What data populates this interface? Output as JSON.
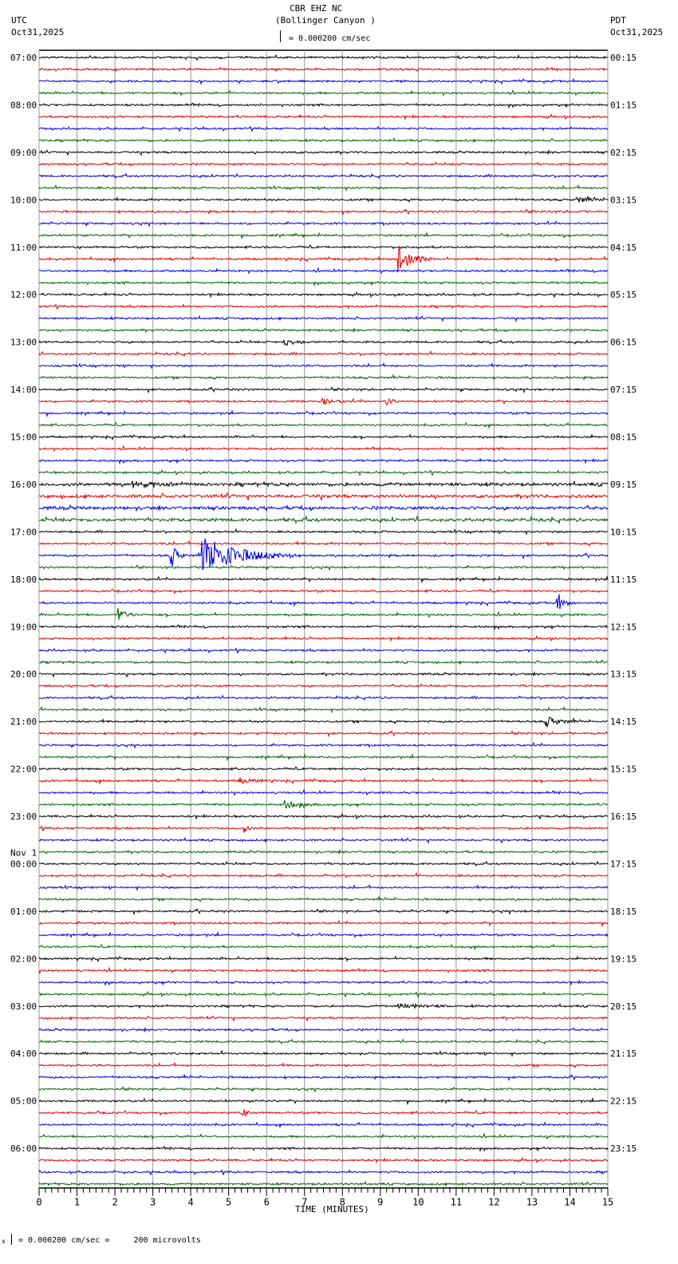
{
  "header": {
    "station": "CBR EHZ NC",
    "location": "(Bollinger Canyon )",
    "scale_text": "= 0.000200 cm/sec",
    "left_tz": "UTC",
    "left_date": "Oct31,2025",
    "right_tz": "PDT",
    "right_date": "Oct31,2025"
  },
  "footer": {
    "scale_prefix": "x",
    "scale_text": "= 0.000200 cm/sec =     200 microvolts"
  },
  "chart_data": {
    "type": "line",
    "title": "CBR EHZ NC (Bollinger Canyon )",
    "xlabel": "TIME (MINUTES)",
    "xlim": [
      0,
      15
    ],
    "x_ticks": [
      "0",
      "1",
      "2",
      "3",
      "4",
      "5",
      "6",
      "7",
      "8",
      "9",
      "10",
      "11",
      "12",
      "13",
      "14",
      "15"
    ],
    "traces_per_hour": 4,
    "trace_colors": [
      "#000000",
      "#e00000",
      "#0000e0",
      "#006400"
    ],
    "left_labels": [
      "07:00",
      "08:00",
      "09:00",
      "10:00",
      "11:00",
      "12:00",
      "13:00",
      "14:00",
      "15:00",
      "16:00",
      "17:00",
      "18:00",
      "19:00",
      "20:00",
      "21:00",
      "22:00",
      "23:00",
      "00:00",
      "01:00",
      "02:00",
      "03:00",
      "04:00",
      "05:00",
      "06:00"
    ],
    "day_change_label": "Nov 1",
    "right_labels": [
      "00:15",
      "01:15",
      "02:15",
      "03:15",
      "04:15",
      "05:15",
      "06:15",
      "07:15",
      "08:15",
      "09:15",
      "10:15",
      "11:15",
      "12:15",
      "13:15",
      "14:15",
      "15:15",
      "16:15",
      "17:15",
      "18:15",
      "19:15",
      "20:15",
      "21:15",
      "22:15",
      "23:15"
    ],
    "events": [
      {
        "trace": 17,
        "minute": 9.5,
        "amplitude": 20,
        "duration": 0.8
      },
      {
        "trace": 42,
        "minute": 3.5,
        "amplitude": 14,
        "duration": 0.4
      },
      {
        "trace": 42,
        "minute": 4.3,
        "amplitude": 24,
        "duration": 2.5
      },
      {
        "trace": 46,
        "minute": 13.7,
        "amplitude": 10,
        "duration": 0.4
      },
      {
        "trace": 47,
        "minute": 2.1,
        "amplitude": 8,
        "duration": 0.5
      },
      {
        "trace": 56,
        "minute": 13.4,
        "amplitude": 6,
        "duration": 0.8
      },
      {
        "trace": 29,
        "minute": 9.2,
        "amplitude": 6,
        "duration": 0.3
      },
      {
        "trace": 29,
        "minute": 7.5,
        "amplitude": 3,
        "duration": 0.8
      },
      {
        "trace": 61,
        "minute": 5.3,
        "amplitude": 3,
        "duration": 1.0
      },
      {
        "trace": 63,
        "minute": 6.5,
        "amplitude": 4,
        "duration": 1.0
      },
      {
        "trace": 65,
        "minute": 5.4,
        "amplitude": 5,
        "duration": 0.3
      },
      {
        "trace": 89,
        "minute": 5.4,
        "amplitude": 5,
        "duration": 0.3
      },
      {
        "trace": 80,
        "minute": 9.5,
        "amplitude": 3,
        "duration": 1.5
      },
      {
        "trace": 24,
        "minute": 6.5,
        "amplitude": 4,
        "duration": 0.8
      },
      {
        "trace": 36,
        "minute": 2.5,
        "amplitude": 3,
        "duration": 1.5
      },
      {
        "trace": 12,
        "minute": 14.2,
        "amplitude": 3,
        "duration": 1.0
      }
    ]
  }
}
